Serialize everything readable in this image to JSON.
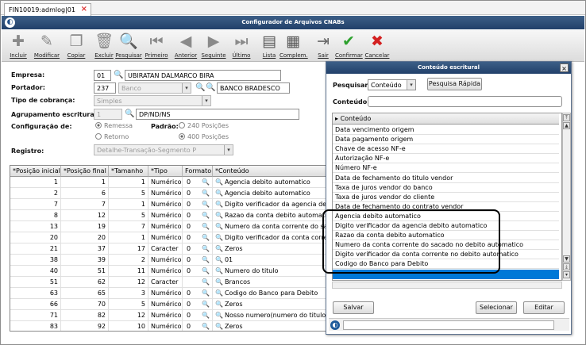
{
  "window": {
    "tab_label": "FIN10019:admlog|01",
    "tab_close": "×",
    "title": "Configurador de Arquivos CNABs"
  },
  "toolbar": [
    {
      "name": "incluir",
      "label": "Incluir",
      "icon": "✚",
      "color": "#8a8a8a"
    },
    {
      "name": "modificar",
      "label": "Modificar",
      "icon": "✎",
      "color": "#8a8a8a"
    },
    {
      "name": "copiar",
      "label": "Copiar",
      "icon": "❐",
      "color": "#8a8a8a"
    },
    {
      "name": "excluir",
      "label": "Excluir",
      "icon": "🗑",
      "color": "#8a8a8a"
    },
    {
      "name": "pesquisar",
      "label": "Pesquisar",
      "icon": "🔍",
      "color": "#555555"
    },
    {
      "name": "primeiro",
      "label": "Primeiro",
      "icon": "⏮",
      "color": "#8a8a8a"
    },
    {
      "name": "anterior",
      "label": "Anterior",
      "icon": "◀",
      "color": "#8a8a8a"
    },
    {
      "name": "seguinte",
      "label": "Seguinte",
      "icon": "▶",
      "color": "#8a8a8a"
    },
    {
      "name": "ultimo",
      "label": "Último",
      "icon": "⏭",
      "color": "#8a8a8a"
    },
    {
      "name": "lista",
      "label": "Lista",
      "icon": "▤",
      "color": "#555555"
    },
    {
      "name": "complem",
      "label": "Complem.",
      "icon": "▦",
      "color": "#555555"
    },
    {
      "name": "sair",
      "label": "Sair",
      "icon": "⇥",
      "color": "#666666"
    },
    {
      "name": "confirmar",
      "label": "Confirmar",
      "icon": "✔",
      "color": "#2da12d"
    },
    {
      "name": "cancelar",
      "label": "Cancelar",
      "icon": "✖",
      "color": "#d32020"
    }
  ],
  "form": {
    "empresa": {
      "label": "Empresa:",
      "code": "01",
      "name": "UBIRATAN DALMARCO BIRA"
    },
    "portador": {
      "label": "Portador:",
      "code": "237",
      "type": "Banco",
      "name": "BANCO BRADESCO"
    },
    "tipo_cobranca": {
      "label": "Tipo de cobrança:",
      "value": "Simples"
    },
    "agrupamento": {
      "label": "Agrupamento escritural:",
      "code": "1",
      "name": "DP/ND/NS"
    },
    "configuracao": {
      "label": "Configuração de:",
      "opt1": "Remessa",
      "opt2": "Retorno"
    },
    "padrao": {
      "label": "Padrão:",
      "opt1": "240 Posições",
      "opt2": "400 Posições"
    },
    "registro": {
      "label": "Registro:",
      "value": "Detalhe-Transação-Segmento P"
    }
  },
  "grid": {
    "headers": [
      "*Posição inicial",
      "*Posição final",
      "*Tamanho",
      "*Tipo",
      "Formato",
      "*Conteúdo"
    ],
    "rows": [
      [
        "1",
        "1",
        "1",
        "Numérico",
        "0",
        "Agencia debito automatico"
      ],
      [
        "2",
        "6",
        "5",
        "Numérico",
        "0",
        "Agencia debito automatico"
      ],
      [
        "7",
        "7",
        "1",
        "Numérico",
        "0",
        "Digito verificador da agencia debito automatico"
      ],
      [
        "8",
        "12",
        "5",
        "Numérico",
        "0",
        "Razao da conta debito automatico"
      ],
      [
        "13",
        "19",
        "7",
        "Numérico",
        "0",
        "Numero da conta corrente do sacado no debit"
      ],
      [
        "20",
        "20",
        "1",
        "Numérico",
        "0",
        "Digito verificador da conta corrente no debit"
      ],
      [
        "21",
        "37",
        "17",
        "Caracter",
        "0",
        "Zeros"
      ],
      [
        "38",
        "39",
        "2",
        "Numérico",
        "0",
        "01"
      ],
      [
        "40",
        "51",
        "11",
        "Numérico",
        "0",
        "Numero do titulo"
      ],
      [
        "51",
        "62",
        "12",
        "Caracter",
        "",
        "Brancos"
      ],
      [
        "63",
        "65",
        "3",
        "Numérico",
        "0",
        "Codigo do Banco para Debito"
      ],
      [
        "66",
        "70",
        "5",
        "Numérico",
        "0",
        "Zeros"
      ],
      [
        "71",
        "82",
        "12",
        "Numérico",
        "0",
        "Nosso numero(numero do titulo bancario)"
      ],
      [
        "83",
        "92",
        "10",
        "Numérico",
        "0",
        "Zeros"
      ]
    ]
  },
  "dialog": {
    "title": "Conteúdo escritural",
    "close": "×",
    "pesquisar_label": "Pesquisar:",
    "pesquisar_value": "Conteúdo",
    "pesquisa_rapida": "Pesquisa Rápida",
    "conteudo_label": "Conteúdo:",
    "conteudo_value": "",
    "list_header": "Conteúdo",
    "items": [
      "Data vencimento origem",
      "Data pagamento origem",
      "Chave de acesso NF-e",
      "Autorização NF-e",
      "Número NF-e",
      "Data de fechamento do titulo vendor",
      "Taxa de juros vendor do banco",
      "Taxa de juros vendor do cliente",
      "Data de fechamento do contrato vendor",
      "Agencia debito automatico",
      "Digito verificador da agencia debito automatico",
      "Razao da conta debito automatico",
      "Numero da conta corrente do sacado no debito automatico",
      "Digito verificador da conta corrente no debito automatico",
      "Codigo do Banco para Debito",
      ""
    ],
    "selected_index": 15,
    "salvar": "Salvar",
    "selecionar": "Selecionar",
    "editar": "Editar"
  }
}
